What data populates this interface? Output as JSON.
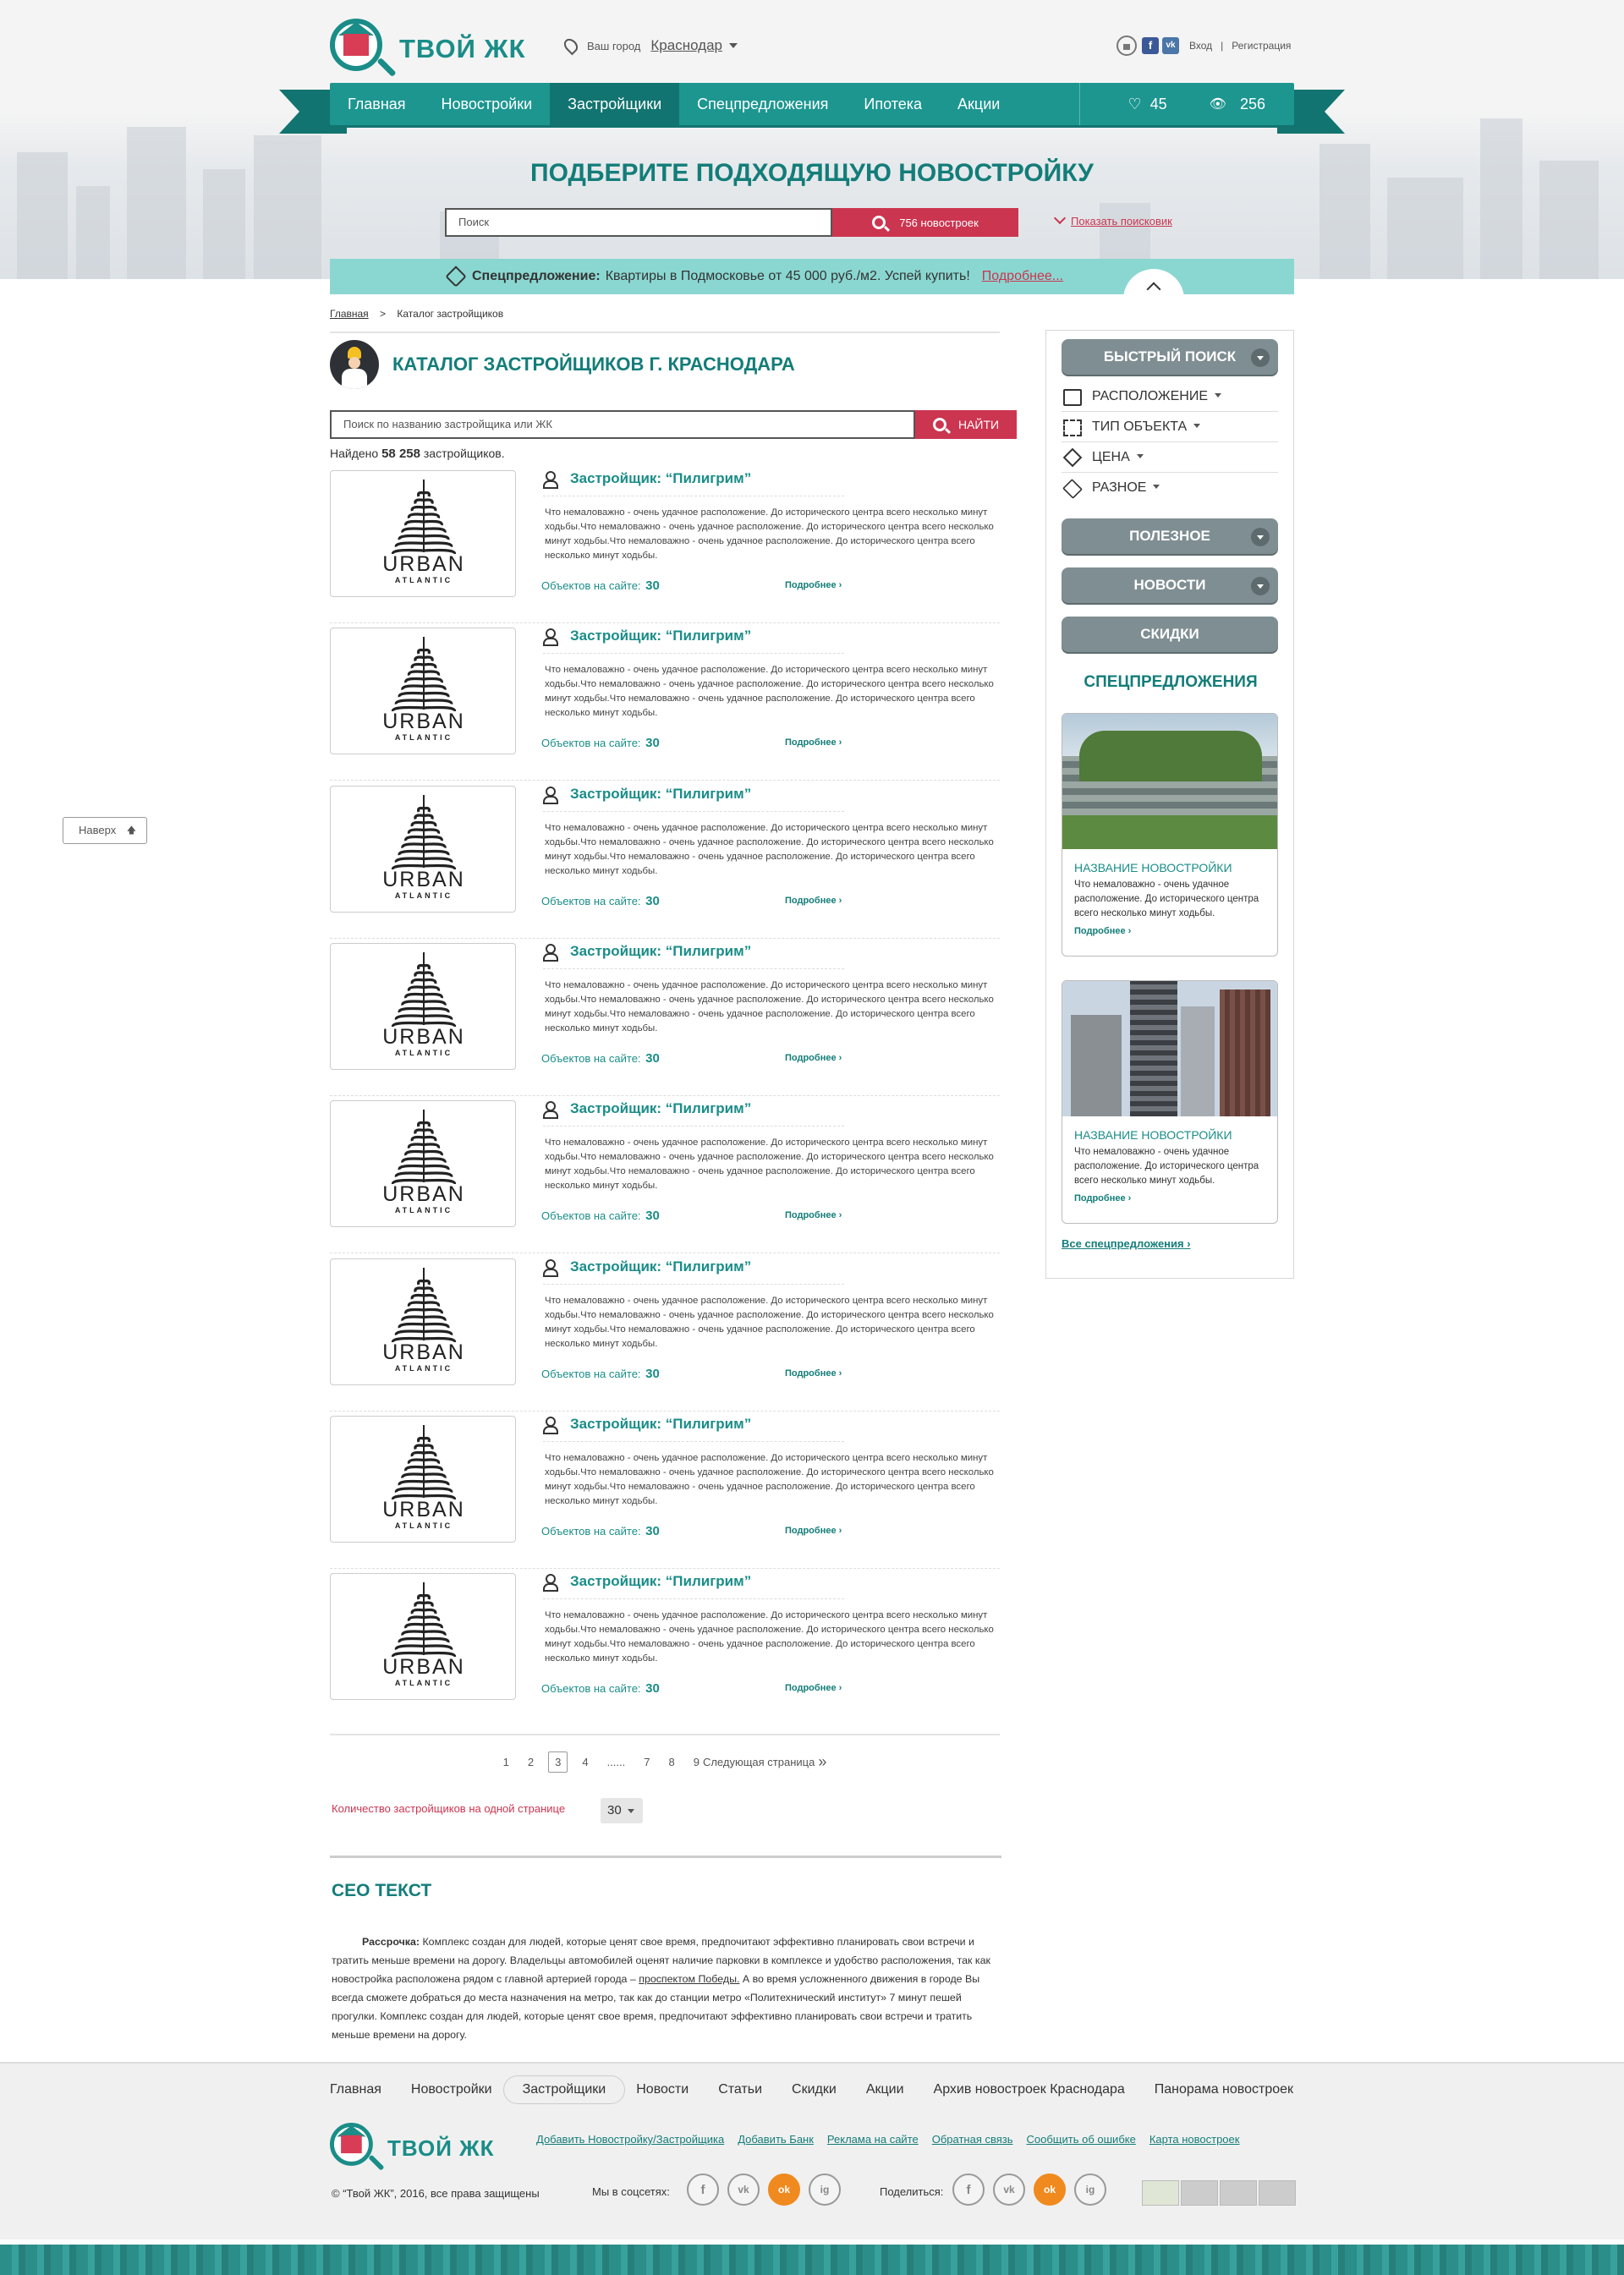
{
  "header": {
    "logo_text": "ТВОЙ ЖК",
    "city_label": "Ваш город",
    "city_value": "Краснодар",
    "login": "Вход",
    "register": "Регистрация",
    "divider": "|",
    "fb": "f",
    "vk": "vk"
  },
  "nav": {
    "items": [
      "Главная",
      "Новостройки",
      "Застройщики",
      "Спецпредложения",
      "Ипотека",
      "Акции"
    ],
    "favorites": "45",
    "views": "256"
  },
  "hero": {
    "title": "ПОДБЕРИТЕ ПОДХОДЯЩУЮ НОВОСТРОЙКУ",
    "search_placeholder": "Поиск",
    "search_button": "756 новостроек",
    "show_advanced": "Показать поисковик"
  },
  "promo": {
    "label": "Спецпредложение:",
    "text": "Квартиры в Подмосковье от 45 000 руб./м2. Успей купить!",
    "more": "Подробнее..."
  },
  "breadcrumb": {
    "home": "Главная",
    "sep": ">",
    "current": "Каталог застройщиков"
  },
  "catalog": {
    "title": "КАТАЛОГ ЗАСТРОЙЩИКОВ Г. КРАСНОДАРА",
    "search_placeholder": "Поиск по названию застройщика или ЖК",
    "search_button": "НАЙТИ",
    "found_prefix": "Найдено",
    "found_count": "58 258",
    "found_suffix": "застройщиков."
  },
  "developers": [
    {
      "name": "Застройщик: “Пилигрим”",
      "logo_main": "URBAN",
      "logo_sub": "ATLANTIC",
      "objects_label": "Объектов на сайте:",
      "objects": "30",
      "more": "Подробнее ›",
      "desc": "Что немаловажно - очень удачное расположение. До исторического центра всего несколько минут ходьбы.Что немаловажно - очень удачное расположение. До исторического центра всего несколько минут ходьбы.Что немаловажно - очень удачное расположение. До исторического центра всего несколько минут ходьбы."
    },
    {
      "name": "Застройщик: “Пилигрим”",
      "logo_main": "URBAN",
      "logo_sub": "ATLANTIC",
      "objects_label": "Объектов на сайте:",
      "objects": "30",
      "more": "Подробнее ›",
      "desc": "Что немаловажно - очень удачное расположение. До исторического центра всего несколько минут ходьбы.Что немаловажно - очень удачное расположение. До исторического центра всего несколько минут ходьбы.Что немаловажно - очень удачное расположение. До исторического центра всего несколько минут ходьбы."
    },
    {
      "name": "Застройщик: “Пилигрим”",
      "logo_main": "URBAN",
      "logo_sub": "ATLANTIC",
      "objects_label": "Объектов на сайте:",
      "objects": "30",
      "more": "Подробнее ›",
      "desc": "Что немаловажно - очень удачное расположение. До исторического центра всего несколько минут ходьбы.Что немаловажно - очень удачное расположение. До исторического центра всего несколько минут ходьбы.Что немаловажно - очень удачное расположение. До исторического центра всего несколько минут ходьбы."
    },
    {
      "name": "Застройщик: “Пилигрим”",
      "logo_main": "URBAN",
      "logo_sub": "ATLANTIC",
      "objects_label": "Объектов на сайте:",
      "objects": "30",
      "more": "Подробнее ›",
      "desc": "Что немаловажно - очень удачное расположение. До исторического центра всего несколько минут ходьбы.Что немаловажно - очень удачное расположение. До исторического центра всего несколько минут ходьбы.Что немаловажно - очень удачное расположение. До исторического центра всего несколько минут ходьбы."
    },
    {
      "name": "Застройщик: “Пилигрим”",
      "logo_main": "URBAN",
      "logo_sub": "ATLANTIC",
      "objects_label": "Объектов на сайте:",
      "objects": "30",
      "more": "Подробнее ›",
      "desc": "Что немаловажно - очень удачное расположение. До исторического центра всего несколько минут ходьбы.Что немаловажно - очень удачное расположение. До исторического центра всего несколько минут ходьбы.Что немаловажно - очень удачное расположение. До исторического центра всего несколько минут ходьбы."
    },
    {
      "name": "Застройщик: “Пилигрим”",
      "logo_main": "URBAN",
      "logo_sub": "ATLANTIC",
      "objects_label": "Объектов на сайте:",
      "objects": "30",
      "more": "Подробнее ›",
      "desc": "Что немаловажно - очень удачное расположение. До исторического центра всего несколько минут ходьбы.Что немаловажно - очень удачное расположение. До исторического центра всего несколько минут ходьбы.Что немаловажно - очень удачное расположение. До исторического центра всего несколько минут ходьбы."
    },
    {
      "name": "Застройщик: “Пилигрим”",
      "logo_main": "URBAN",
      "logo_sub": "ATLANTIC",
      "objects_label": "Объектов на сайте:",
      "objects": "30",
      "more": "Подробнее ›",
      "desc": "Что немаловажно - очень удачное расположение. До исторического центра всего несколько минут ходьбы.Что немаловажно - очень удачное расположение. До исторического центра всего несколько минут ходьбы.Что немаловажно - очень удачное расположение. До исторического центра всего несколько минут ходьбы."
    },
    {
      "name": "Застройщик: “Пилигрим”",
      "logo_main": "URBAN",
      "logo_sub": "ATLANTIC",
      "objects_label": "Объектов на сайте:",
      "objects": "30",
      "more": "Подробнее ›",
      "desc": "Что немаловажно - очень удачное расположение. До исторического центра всего несколько минут ходьбы.Что немаловажно - очень удачное расположение. До исторического центра всего несколько минут ходьбы.Что немаловажно - очень удачное расположение. До исторического центра всего несколько минут ходьбы."
    }
  ],
  "pagination": {
    "pages": [
      "1",
      "2",
      "3",
      "4",
      "......",
      "7",
      "8",
      "9"
    ],
    "current": "3",
    "next": "Следующая страница",
    "next_arrow": "»",
    "per_page_label": "Количество застройщиков на одной странице",
    "per_page_value": "30"
  },
  "seo": {
    "title": "СЕО ТЕКСТ",
    "lead": "Рассрочка:",
    "text1": " Комплекс создан для людей, которые ценят свое время, предпочитают эффективно планировать свои встречи и тратить меньше времени на дорогу. Владельцы автомобилей оценят наличие парковки в комплексе и удобство расположения, так как новостройка расположена рядом с главной артерией города – ",
    "link": "проспектом Победы.",
    "text2": " А во время усложненного движения в городе Вы всегда сможете добраться до места назначения на метро, так как до станции метро «Политехнический институт» 7 минут пешей прогулки. Комплекс создан для людей, которые ценят свое время, предпочитают эффективно планировать свои встречи и тратить меньше времени на дорогу."
  },
  "to_top": "Наверх",
  "sidebar": {
    "quick_search": "БЫСТРЫЙ ПОИСК",
    "filters": [
      "РАСПОЛОЖЕНИЕ",
      "ТИП ОБЪЕКТА",
      "ЦЕНА",
      "РАЗНОЕ"
    ],
    "useful": "ПОЛЕЗНОЕ",
    "news": "НОВОСТИ",
    "discounts": "СКИДКИ",
    "specials_title": "СПЕЦПРЕДЛОЖЕНИЯ",
    "cards": [
      {
        "name": "НАЗВАНИЕ НОВОСТРОЙКИ",
        "desc": "Что немаловажно - очень удачное расположение. До исторического центра всего несколько минут ходьбы.",
        "more": "Подробнее ›"
      },
      {
        "name": "НАЗВАНИЕ НОВОСТРОЙКИ",
        "desc": "Что немаловажно - очень удачное расположение. До исторического центра всего несколько минут ходьбы.",
        "more": "Подробнее ›"
      }
    ],
    "all_specials": "Все спецпредложения ›"
  },
  "footer": {
    "nav": [
      "Главная",
      "Новостройки",
      "Застройщики",
      "Новости",
      "Статьи",
      "Скидки",
      "Акции",
      "Архив новостроек Краснодара",
      "Панорама новостроек"
    ],
    "logo_text": "ТВОЙ ЖК",
    "links": [
      "Добавить Новостройку/Застройщика",
      "Добавить Банк",
      "Реклама на сайте",
      "Обратная связь",
      "Сообщить об ошибке",
      "Карта новостроек"
    ],
    "copyright": "© “Твой ЖК”, 2016, все права защищены",
    "social_label": "Мы в соцсетях:",
    "share_label": "Поделиться:",
    "social_icons": [
      "f",
      "vk",
      "ok",
      "ig"
    ]
  },
  "colors": {
    "teal": "#1d9690",
    "teal_dark": "#127470",
    "accent_red": "#cb3550",
    "promo_bg": "#8ad7d1",
    "sidebar_pill": "#7f8e92"
  }
}
